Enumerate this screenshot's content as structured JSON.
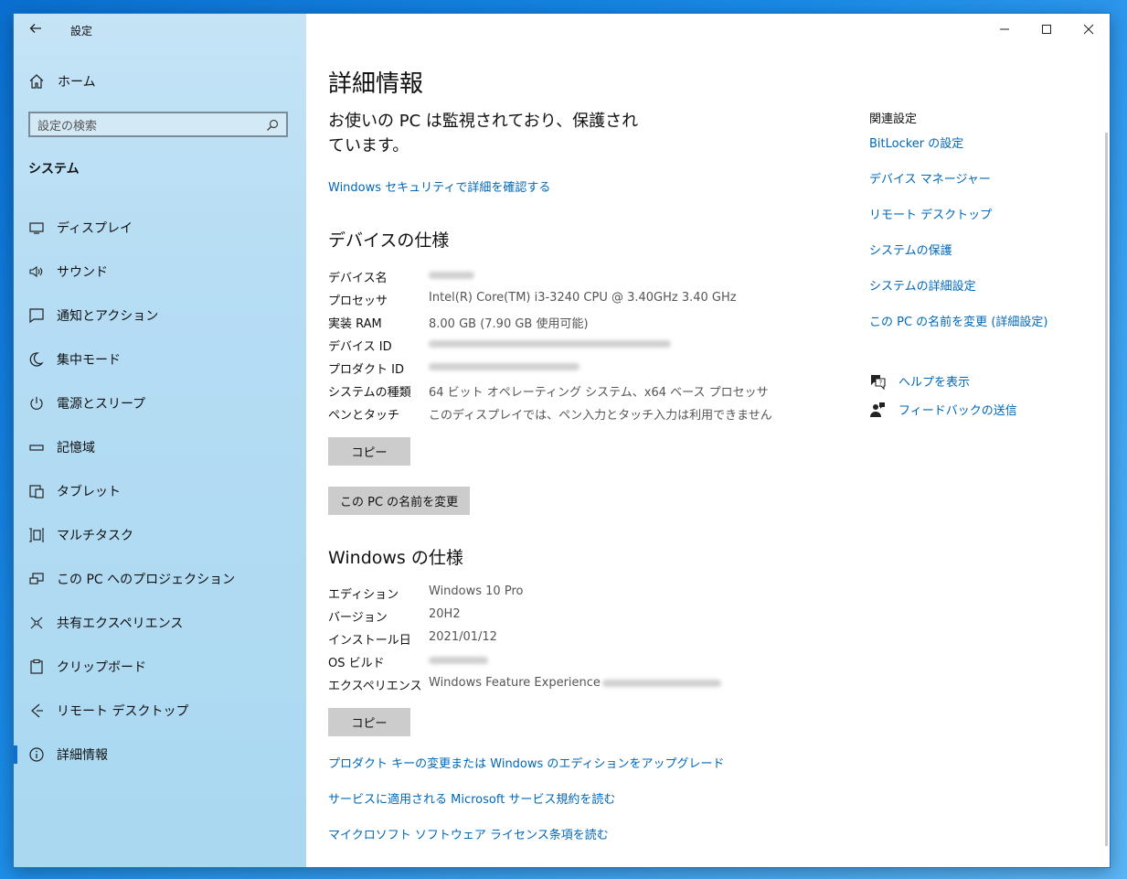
{
  "app": {
    "title": "設定"
  },
  "sidebar": {
    "home_label": "ホーム",
    "search_placeholder": "設定の検索",
    "section_title": "システム",
    "items": [
      {
        "label": "ディスプレイ",
        "icon": "display-icon"
      },
      {
        "label": "サウンド",
        "icon": "speaker-icon"
      },
      {
        "label": "通知とアクション",
        "icon": "notification-icon"
      },
      {
        "label": "集中モード",
        "icon": "moon-icon"
      },
      {
        "label": "電源とスリープ",
        "icon": "power-icon"
      },
      {
        "label": "記憶域",
        "icon": "storage-icon"
      },
      {
        "label": "タブレット",
        "icon": "tablet-icon"
      },
      {
        "label": "マルチタスク",
        "icon": "multitask-icon"
      },
      {
        "label": "この PC へのプロジェクション",
        "icon": "projection-icon"
      },
      {
        "label": "共有エクスペリエンス",
        "icon": "share-icon"
      },
      {
        "label": "クリップボード",
        "icon": "clipboard-icon"
      },
      {
        "label": "リモート デスクトップ",
        "icon": "remote-desktop-icon"
      },
      {
        "label": "詳細情報",
        "icon": "info-icon",
        "active": true
      }
    ]
  },
  "main": {
    "title": "詳細情報",
    "security_status": "お使いの PC は監視されており、保護されています。",
    "security_link": "Windows セキュリティで詳細を確認する",
    "device_spec": {
      "heading": "デバイスの仕様",
      "rows": [
        {
          "key": "デバイス名",
          "value": ""
        },
        {
          "key": "プロセッサ",
          "value": "Intel(R) Core(TM) i3-3240 CPU @ 3.40GHz   3.40 GHz"
        },
        {
          "key": "実装 RAM",
          "value": "8.00 GB (7.90 GB 使用可能)"
        },
        {
          "key": "デバイス ID",
          "value": ""
        },
        {
          "key": "プロダクト ID",
          "value": ""
        },
        {
          "key": "システムの種類",
          "value": "64 ビット オペレーティング システム、x64 ベース プロセッサ"
        },
        {
          "key": "ペンとタッチ",
          "value": "このディスプレイでは、ペン入力とタッチ入力は利用できません"
        }
      ],
      "copy_button": "コピー",
      "rename_button": "この PC の名前を変更"
    },
    "windows_spec": {
      "heading": "Windows の仕様",
      "rows": [
        {
          "key": "エディション",
          "value": "Windows 10 Pro"
        },
        {
          "key": "バージョン",
          "value": "20H2"
        },
        {
          "key": "インストール日",
          "value": "2021/01/12"
        },
        {
          "key": "OS ビルド",
          "value": ""
        },
        {
          "key": "エクスペリエンス",
          "value": "Windows Feature Experience"
        }
      ],
      "copy_button": "コピー"
    },
    "links": [
      "プロダクト キーの変更または Windows のエディションをアップグレード",
      "サービスに適用される Microsoft サービス規約を読む",
      "マイクロソフト ソフトウェア ライセンス条項を読む"
    ]
  },
  "related": {
    "title": "関連設定",
    "links": [
      "BitLocker の設定",
      "デバイス マネージャー",
      "リモート デスクトップ",
      "システムの保護",
      "システムの詳細設定",
      "この PC の名前を変更 (詳細設定)"
    ],
    "help_label": "ヘルプを表示",
    "feedback_label": "フィードバックの送信"
  },
  "colors": {
    "accent": "#0067b8",
    "sidebar": "#b6ddf4",
    "button": "#cccccc"
  }
}
